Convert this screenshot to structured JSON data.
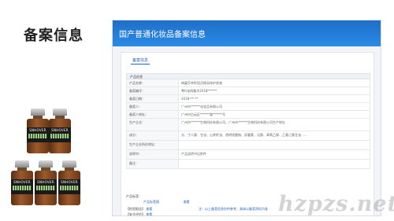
{
  "slide": {
    "title": "备案信息"
  },
  "products": {
    "label": "SNHOVER",
    "count": 5
  },
  "panel": {
    "header_title": "国产普通化妆品备案信息",
    "tab_label": "备案信息",
    "section_title": "产品信息",
    "rows": [
      {
        "key": "产品名称：",
        "value": "绮蔓莎茶籽肌活焕采修护原液"
      },
      {
        "key": "备案编号：",
        "value": "粤G妆网备字2018******"
      },
      {
        "key": "备案日期：",
        "value": "2018-**-**"
      },
      {
        "key": "备案人：",
        "value": "广州市******化妆品有限公司"
      },
      {
        "key": "备案人地址：",
        "value": "广州市白云区******路******号"
      },
      {
        "key": "生产企业：",
        "value": "广州市******生物科技有限公司，广州市******生物科技有限公司生产地址"
      },
      {
        "key": "成分：",
        "value": "水、丁二醇、甘油、山茶籽油、透明质酸钠、尿囊素、泛醇、苯氧乙醇、乙基己基甘油……"
      },
      {
        "key": "生产企业所在地址：",
        "value": ""
      },
      {
        "key": "说明书：",
        "value": "产品说明书见附件"
      },
      {
        "key": "备注：",
        "value": ""
      }
    ],
    "attachments_label": "产品标签：",
    "attachment_link_1": "产品标签图",
    "attachment_link_2": "查看",
    "check_label_1": "【检验报告】",
    "check_link_1": "查看",
    "check_label_2": "【安全评估】",
    "check_link_2": "查看",
    "footer": "注：以上备案信息仅供参考，具体以备案资料为准"
  },
  "watermark": "hzpzs.net"
}
